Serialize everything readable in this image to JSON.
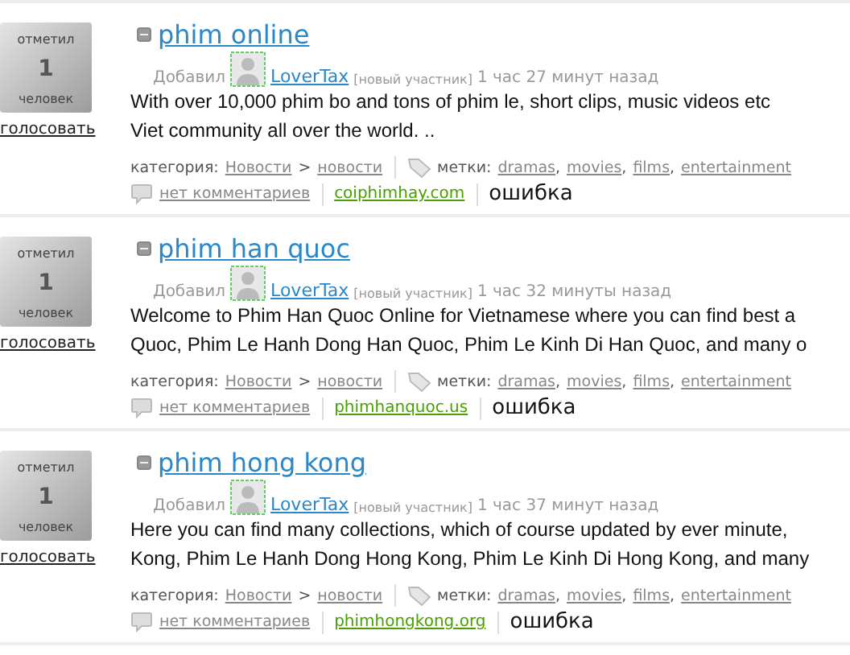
{
  "entries": [
    {
      "vote": {
        "top": "отметил",
        "count": "1",
        "bottom": "человек"
      },
      "vote_link": "голосовать",
      "title": "phim online",
      "added": "Добавил",
      "author": "LoverTax",
      "badge": "[новый участник]",
      "time": "1 час 27 минут назад",
      "description": [
        "With over 10,000 phim bo and tons of phim le, short clips, music videos etc",
        "Viet community all over the world. .."
      ],
      "category_label": "категория:",
      "category": "Новости",
      "arrow": ">",
      "subcategory": "новости",
      "tags_label": "метки:",
      "tags": [
        "dramas",
        "movies",
        "films",
        "entertainment"
      ],
      "tag_separator": ",",
      "comments": "нет комментариев",
      "site": "coiphimhay.com",
      "error": "ошибка"
    },
    {
      "vote": {
        "top": "отметил",
        "count": "1",
        "bottom": "человек"
      },
      "vote_link": "голосовать",
      "title": "phim han quoc",
      "added": "Добавил",
      "author": "LoverTax",
      "badge": "[новый участник]",
      "time": "1 час 32 минуты назад",
      "description": [
        "Welcome to Phim Han Quoc Online for Vietnamese where you can find best a",
        "Quoc, Phim Le Hanh Dong Han Quoc, Phim Le Kinh Di Han Quoc, and many o"
      ],
      "category_label": "категория:",
      "category": "Новости",
      "arrow": ">",
      "subcategory": "новости",
      "tags_label": "метки:",
      "tags": [
        "dramas",
        "movies",
        "films",
        "entertainment"
      ],
      "tag_separator": ",",
      "comments": "нет комментариев",
      "site": "phimhanquoc.us",
      "error": "ошибка"
    },
    {
      "vote": {
        "top": "отметил",
        "count": "1",
        "bottom": "человек"
      },
      "vote_link": "голосовать",
      "title": "phim hong kong",
      "added": "Добавил",
      "author": "LoverTax",
      "badge": "[новый участник]",
      "time": "1 час 37 минут назад",
      "description": [
        "Here you can find many collections, which of course updated by ever minute,",
        "Kong, Phim Le Hanh Dong Hong Kong, Phim Le Kinh Di Hong Kong, and many"
      ],
      "category_label": "категория:",
      "category": "Новости",
      "arrow": ">",
      "subcategory": "новости",
      "tags_label": "метки:",
      "tags": [
        "dramas",
        "movies",
        "films",
        "entertainment"
      ],
      "tag_separator": ",",
      "comments": "нет комментариев",
      "site": "phimhongkong.org",
      "error": "ошибка"
    }
  ]
}
